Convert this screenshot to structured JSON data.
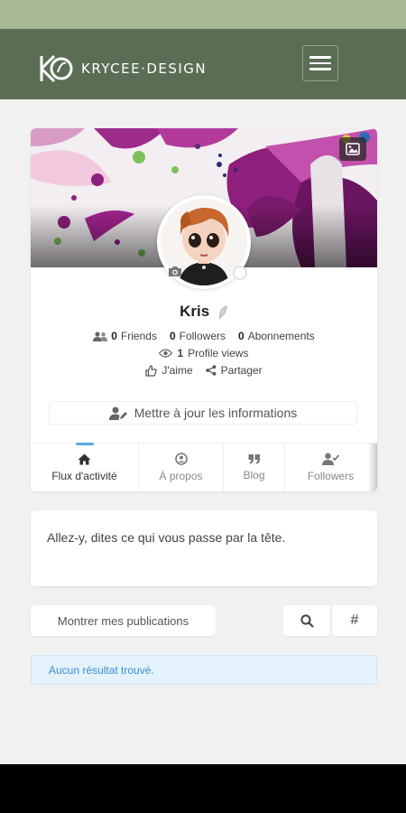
{
  "app": {
    "brand_text": "KRYCEE·DESIGN",
    "brand_color": "#5a6e55",
    "statusbar_color": "#a6b896"
  },
  "profile": {
    "name": "Kris",
    "stats": {
      "friends_count": "0",
      "friends_label": "Friends",
      "followers_count": "0",
      "followers_label": "Followers",
      "subscriptions_count": "0",
      "subscriptions_label": "Abonnements"
    },
    "views_count": "1",
    "views_label": "Profile views",
    "like_label": "J'aime",
    "share_label": "Partager",
    "update_button_label": "Mettre à jour les informations"
  },
  "tabs": [
    {
      "label": "Flux d'activité",
      "icon": "home-icon",
      "active": true
    },
    {
      "label": "À propos",
      "icon": "user-circle-icon",
      "active": false
    },
    {
      "label": "Blog",
      "icon": "quote-icon",
      "active": false
    },
    {
      "label": "Followers",
      "icon": "user-check-icon",
      "active": false
    }
  ],
  "composer": {
    "placeholder": "Allez-y, dites ce qui vous passe par la tête."
  },
  "filters": {
    "show_posts_label": "Montrer mes publications",
    "search_icon": "search-icon",
    "hashtag_label": "#"
  },
  "alert": {
    "message": "Aucun résultat trouvé.",
    "accent_color": "#3b8fd0"
  }
}
